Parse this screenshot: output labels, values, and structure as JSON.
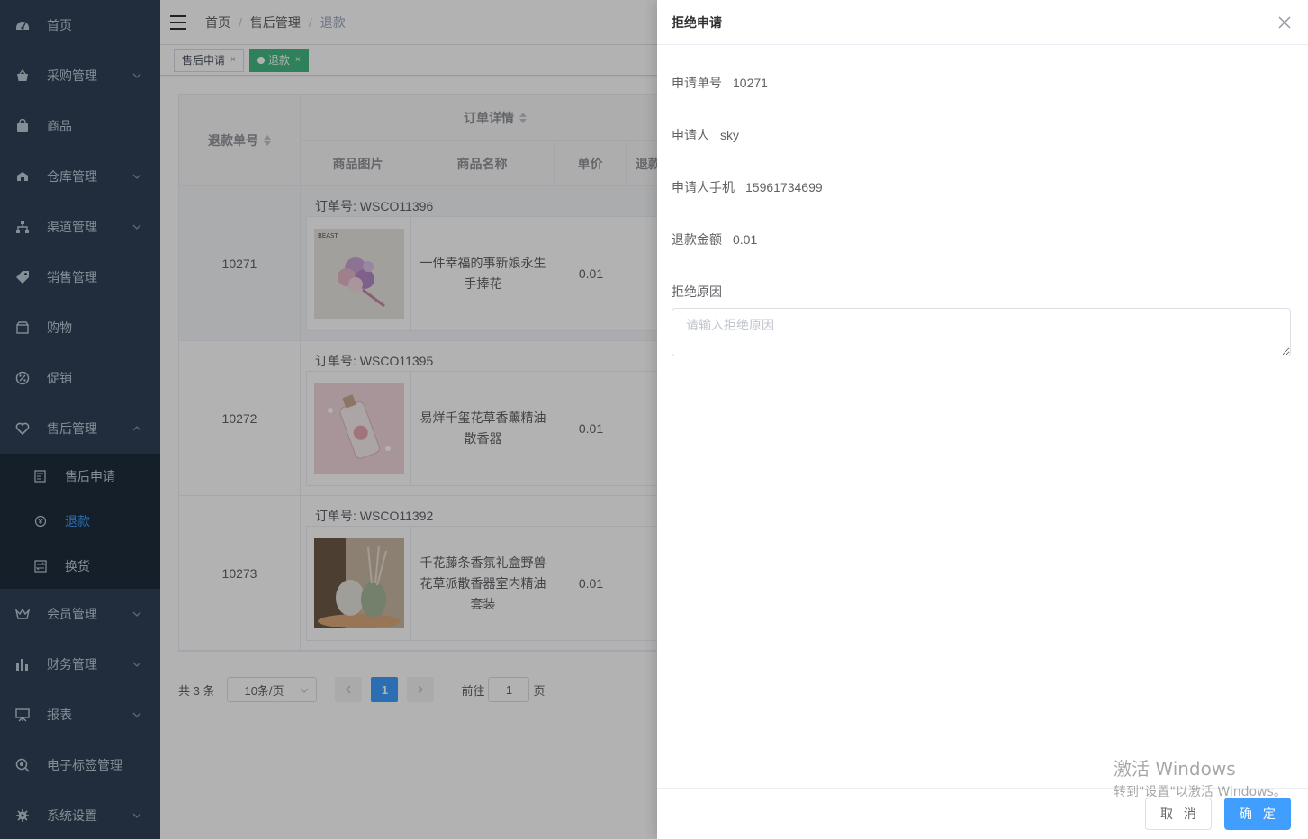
{
  "sidebar": {
    "items": [
      {
        "label": "首页",
        "icon": "dashboard-icon",
        "has_arrow": false
      },
      {
        "label": "采购管理",
        "icon": "basket-icon",
        "has_arrow": true
      },
      {
        "label": "商品",
        "icon": "shopping-bag-icon",
        "has_arrow": false
      },
      {
        "label": "仓库管理",
        "icon": "warehouse-icon",
        "has_arrow": true
      },
      {
        "label": "渠道管理",
        "icon": "channel-tree-icon",
        "has_arrow": true
      },
      {
        "label": "销售管理",
        "icon": "price-tag-icon",
        "has_arrow": false
      },
      {
        "label": "购物",
        "icon": "shop-icon",
        "has_arrow": false
      },
      {
        "label": "促销",
        "icon": "discount-icon",
        "has_arrow": false
      },
      {
        "label": "售后管理",
        "icon": "after-sale-icon",
        "has_arrow": true,
        "expanded": true
      }
    ],
    "submenu": [
      {
        "label": "售后申请",
        "icon": "document-icon"
      },
      {
        "label": "退款",
        "icon": "refund-icon",
        "active": true
      },
      {
        "label": "换货",
        "icon": "exchange-icon"
      }
    ],
    "items_after": [
      {
        "label": "会员管理",
        "icon": "crown-icon",
        "has_arrow": true
      },
      {
        "label": "财务管理",
        "icon": "finance-icon",
        "has_arrow": true
      },
      {
        "label": "报表",
        "icon": "report-icon",
        "has_arrow": true
      },
      {
        "label": "电子标签管理",
        "icon": "rfid-icon",
        "has_arrow": false
      },
      {
        "label": "系统设置",
        "icon": "settings-gear-icon",
        "has_arrow": true
      }
    ]
  },
  "breadcrumb": [
    "首页",
    "售后管理",
    "退款"
  ],
  "tags": [
    {
      "label": "售后申请",
      "active": false
    },
    {
      "label": "退款",
      "active": true
    }
  ],
  "table": {
    "headers": {
      "refund_no": "退款单号",
      "order_detail": "订单详情",
      "image": "商品图片",
      "name": "商品名称",
      "price": "单价",
      "refund_partial": "退款"
    },
    "order_prefix": "订单号: ",
    "rows": [
      {
        "refund_no": "10271",
        "order_no": "WSCO11396",
        "product": "一件幸福的事新娘永生手捧花",
        "price": "0.01"
      },
      {
        "refund_no": "10272",
        "order_no": "WSCO11395",
        "product": "易烊千玺花草香薰精油散香器",
        "price": "0.01"
      },
      {
        "refund_no": "10273",
        "order_no": "WSCO11392",
        "product": "千花藤条香氛礼盒野兽花草派散香器室内精油套装",
        "price": "0.01"
      }
    ]
  },
  "pagination": {
    "total_text": "共 3 条",
    "page_size": "10条/页",
    "current_page": "1",
    "goto_label": "前往",
    "goto_value": "1",
    "page_unit": "页"
  },
  "drawer": {
    "title": "拒绝申请",
    "fields": [
      {
        "label": "申请单号",
        "value": "10271"
      },
      {
        "label": "申请人",
        "value": "sky"
      },
      {
        "label": "申请人手机",
        "value": "15961734699"
      },
      {
        "label": "退款金额",
        "value": "0.01"
      }
    ],
    "reason_label": "拒绝原因",
    "reason_placeholder": "请输入拒绝原因",
    "cancel_label": "取 消",
    "ok_label": "确 定"
  },
  "watermark": {
    "line1": "激活 Windows",
    "line2": "转到\"设置\"以激活 Windows。"
  },
  "colors": {
    "sidebar_bg": "#304156",
    "submenu_bg": "#1f2d3d",
    "primary": "#409eff",
    "tag_active": "#42b983"
  }
}
